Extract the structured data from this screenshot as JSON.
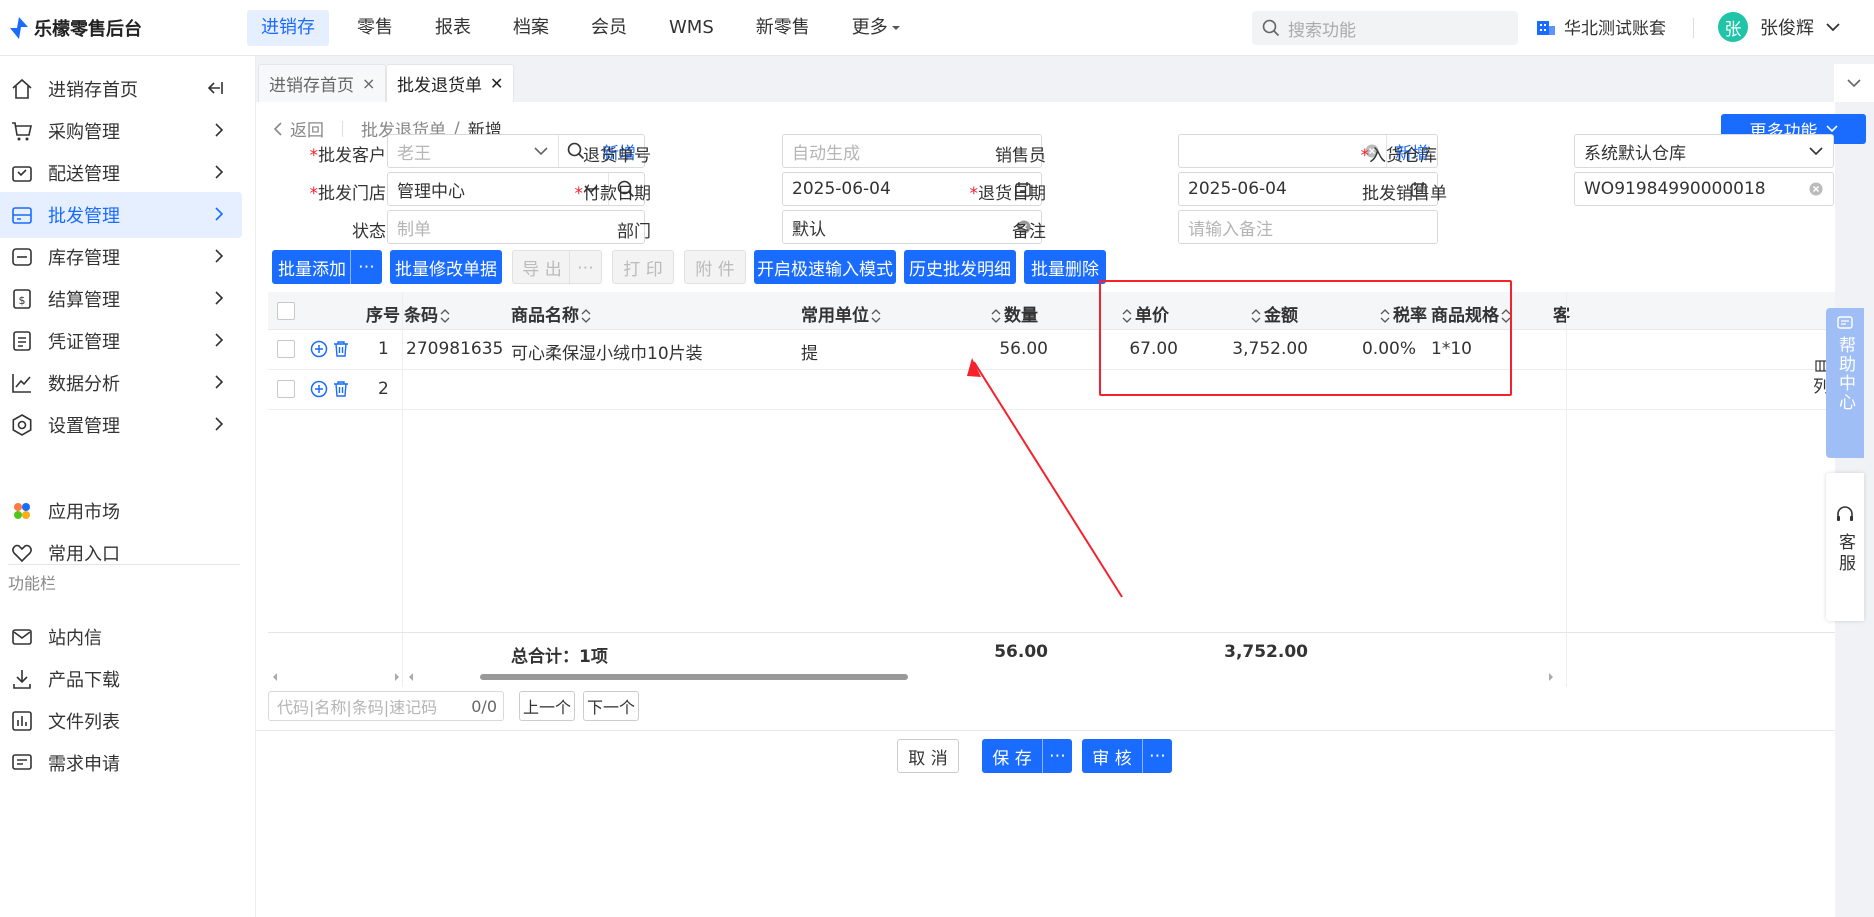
{
  "app": {
    "logo_text": "乐檬零售后台"
  },
  "topnav": [
    {
      "label": "进销存",
      "active": true
    },
    {
      "label": "零售"
    },
    {
      "label": "报表"
    },
    {
      "label": "档案"
    },
    {
      "label": "会员"
    },
    {
      "label": "WMS"
    },
    {
      "label": "新零售"
    },
    {
      "label": "更多"
    }
  ],
  "search": {
    "placeholder": "搜索功能"
  },
  "account": {
    "name": "华北测试账套"
  },
  "user": {
    "avatar": "张",
    "name": "张俊辉"
  },
  "sidebar": {
    "items": [
      {
        "label": "进销存首页",
        "icon": "home-icon"
      },
      {
        "label": "采购管理",
        "icon": "cart-icon"
      },
      {
        "label": "配送管理",
        "icon": "delivery-icon"
      },
      {
        "label": "批发管理",
        "icon": "wholesale-icon",
        "active": true
      },
      {
        "label": "库存管理",
        "icon": "inventory-icon"
      },
      {
        "label": "结算管理",
        "icon": "settlement-icon"
      },
      {
        "label": "凭证管理",
        "icon": "voucher-icon"
      },
      {
        "label": "数据分析",
        "icon": "chart-icon"
      },
      {
        "label": "设置管理",
        "icon": "settings-icon"
      }
    ],
    "extra": [
      {
        "label": "应用市场",
        "icon": "app-market-icon"
      },
      {
        "label": "常用入口",
        "icon": "heart-icon"
      }
    ],
    "section_title": "功能栏",
    "func_items": [
      {
        "label": "站内信",
        "icon": "mail-icon"
      },
      {
        "label": "产品下载",
        "icon": "download-icon"
      },
      {
        "label": "文件列表",
        "icon": "file-list-icon"
      },
      {
        "label": "需求申请",
        "icon": "request-icon"
      }
    ]
  },
  "tabs": [
    {
      "label": "进销存首页",
      "close": "×"
    },
    {
      "label": "批发退货单",
      "close": "✕",
      "active": true
    }
  ],
  "breadcrumb": {
    "back": "返回",
    "parent": "批发退货单",
    "sep": "/",
    "current": "新增"
  },
  "more_functions": "更多功能",
  "form": {
    "customer": {
      "label": "批发客户",
      "placeholder": "老王",
      "add": "新增"
    },
    "return_no": {
      "label": "退货单号",
      "placeholder": "自动生成"
    },
    "salesman": {
      "label": "销售员",
      "add": "新增"
    },
    "warehouse": {
      "label": "入货仓库",
      "value": "系统默认仓库"
    },
    "store": {
      "label": "批发门店",
      "value": "管理中心"
    },
    "pay_date": {
      "label": "付款日期",
      "value": "2025-06-04"
    },
    "return_date": {
      "label": "退货日期",
      "value": "2025-06-04"
    },
    "sales_order": {
      "label": "批发销售单",
      "value": "WO91984990000018"
    },
    "status": {
      "label": "状态",
      "placeholder": "制单"
    },
    "department": {
      "label": "部门",
      "value": "默认"
    },
    "remark": {
      "label": "备注",
      "placeholder": "请输入备注"
    }
  },
  "toolbar": {
    "batch_add": "批量添加",
    "batch_edit": "批量修改单据",
    "export": "导 出",
    "print": "打 印",
    "attach": "附 件",
    "quick_input": "开启极速输入模式",
    "history": "历史批发明细",
    "batch_delete": "批量删除",
    "more": "⋯"
  },
  "table": {
    "headers": {
      "seq": "序号",
      "barcode": "条码",
      "name": "商品名称",
      "unit": "常用单位",
      "qty": "数量",
      "price": "单价",
      "amount": "金额",
      "tax": "税率",
      "spec": "商品规格",
      "cut": "客"
    },
    "rows": [
      {
        "seq": "1",
        "barcode": "270981635",
        "name": "可心柔保湿小绒巾10片装",
        "unit": "提",
        "qty": "56.00",
        "price": "67.00",
        "amount": "3,752.00",
        "tax": "0.00%",
        "spec": "1*10"
      },
      {
        "seq": "2",
        "barcode": "",
        "name": "",
        "unit": "",
        "qty": "",
        "price": "",
        "amount": "",
        "tax": "",
        "spec": ""
      }
    ],
    "footer": {
      "total_label": "总合计：1项",
      "qty": "56.00",
      "amount": "3,752.00"
    }
  },
  "find": {
    "placeholder": "代码|名称|条码|速记码",
    "count": "0/0",
    "prev": "上一个",
    "next": "下一个"
  },
  "bottom": {
    "cancel": "取 消",
    "save": "保 存",
    "audit": "审 核",
    "more": "⋯"
  },
  "right_panel": {
    "help": "帮助中心",
    "service": "客服",
    "column_cut": "列"
  },
  "colors": {
    "primary": "#1a6bff",
    "highlight_box": "#f5222d",
    "arrow": "#f5222d"
  }
}
